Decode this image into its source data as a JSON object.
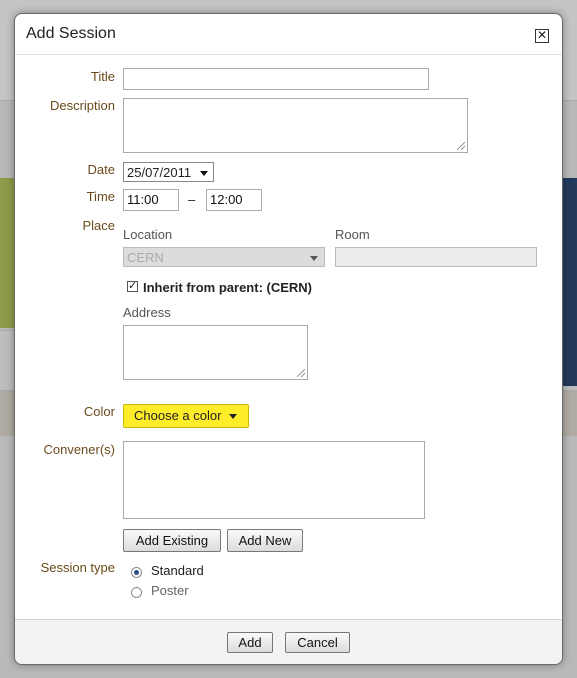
{
  "dialog": {
    "title": "Add Session",
    "close_symbol": "✕"
  },
  "form": {
    "title_label": "Title",
    "title_value": "",
    "description_label": "Description",
    "description_value": "",
    "date_label": "Date",
    "date_value": "25/07/2011",
    "time_label": "Time",
    "time_start": "11:00",
    "time_sep": "–",
    "time_end": "12:00",
    "place_label": "Place",
    "location_label": "Location",
    "location_value": "CERN",
    "room_label": "Room",
    "room_value": "",
    "inherit_checked": true,
    "inherit_mark": "✓",
    "inherit_label": "Inherit from parent: (CERN)",
    "address_label": "Address",
    "address_value": "",
    "color_label": "Color",
    "color_button": "Choose a color",
    "color_button_bg": "#ffed2a",
    "conveners_label": "Convener(s)",
    "add_existing": "Add Existing",
    "add_new": "Add New",
    "session_type_label": "Session type",
    "session_types": [
      {
        "label": "Standard",
        "selected": true
      },
      {
        "label": "Poster",
        "selected": false
      }
    ]
  },
  "footer": {
    "add_button": "Add",
    "cancel_button": "Cancel"
  },
  "colors": {
    "label_brown": "#6b4a1c",
    "page_olive": "#8f9a4a",
    "page_navy": "#243a5c"
  }
}
